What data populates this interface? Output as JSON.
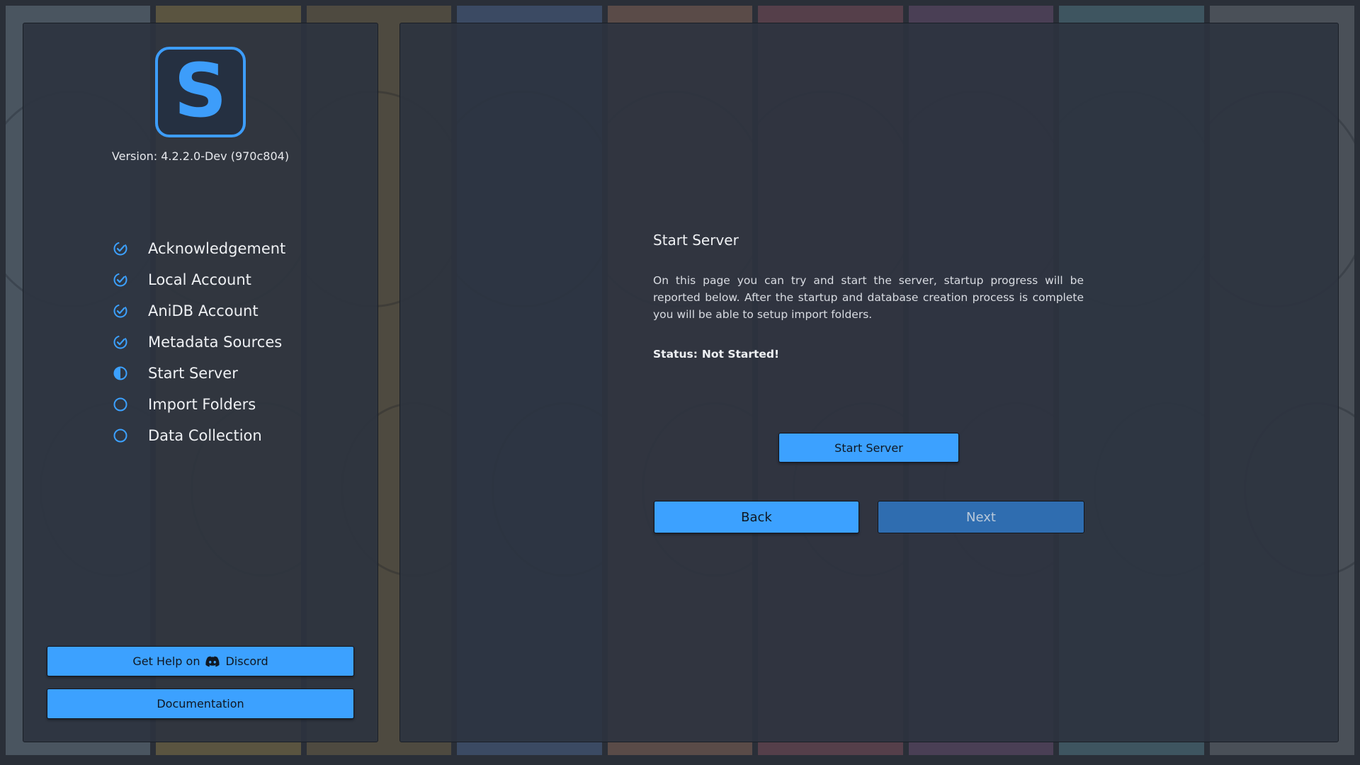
{
  "app": {
    "logo_letter": "S",
    "version": "Version: 4.2.2.0-Dev (970c804)"
  },
  "colors": {
    "accent": "#3ca1ff",
    "panel": "#2c333f",
    "disabled_button": "#2f6db0"
  },
  "steps": [
    {
      "label": "Acknowledgement",
      "state": "done",
      "icon": "check-circle-icon"
    },
    {
      "label": "Local Account",
      "state": "done",
      "icon": "check-circle-icon"
    },
    {
      "label": "AniDB Account",
      "state": "done",
      "icon": "check-circle-icon"
    },
    {
      "label": "Metadata Sources",
      "state": "done",
      "icon": "check-circle-icon"
    },
    {
      "label": "Start Server",
      "state": "current",
      "icon": "half-circle-icon"
    },
    {
      "label": "Import Folders",
      "state": "pending",
      "icon": "empty-circle-icon"
    },
    {
      "label": "Data Collection",
      "state": "pending",
      "icon": "empty-circle-icon"
    }
  ],
  "sidebar": {
    "help_prefix": "Get Help on",
    "help_suffix": "Discord",
    "help_icon": "discord-icon",
    "docs_label": "Documentation"
  },
  "main": {
    "title": "Start Server",
    "description": "On this page you can try and start the server, startup progress will be reported below. After the startup and database creation process is complete you will be able to setup import folders.",
    "status_label": "Status:",
    "status_value": "Not Started!",
    "start_button": "Start Server",
    "back_button": "Back",
    "next_button": "Next"
  }
}
